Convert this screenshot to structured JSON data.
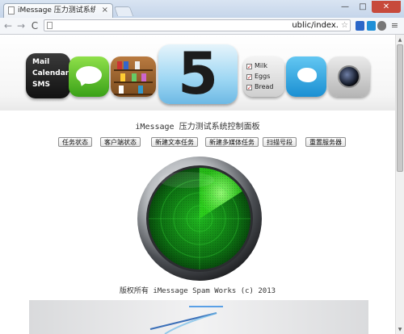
{
  "browser": {
    "tab_title": "iMessage 压力测试系统控制",
    "tab_close": "×",
    "url": "ublic/index.",
    "buttons": {
      "minimize": "—",
      "maximize": "□",
      "close": "✕"
    },
    "nav": {
      "back": "←",
      "forward": "→",
      "reload": "C"
    },
    "star": "☆",
    "menu": "≡"
  },
  "banner": {
    "mail_lines": [
      "Mail",
      "Calendar",
      "SMS"
    ],
    "five": "5",
    "reminders": [
      "Milk",
      "Eggs",
      "Bread"
    ]
  },
  "panel": {
    "title": "iMessage 压力测试系统控制面板",
    "buttons": [
      "任务状态",
      "客户端状态",
      "新建文本任务",
      "新建多媒体任务",
      "扫描号段",
      "重置服务器"
    ]
  },
  "radar": {
    "sweep_color": "#2fd91a",
    "base_color": "#0d6e12"
  },
  "footer": {
    "copyright": "版权所有 iMessage Spam Works (c) 2013"
  }
}
